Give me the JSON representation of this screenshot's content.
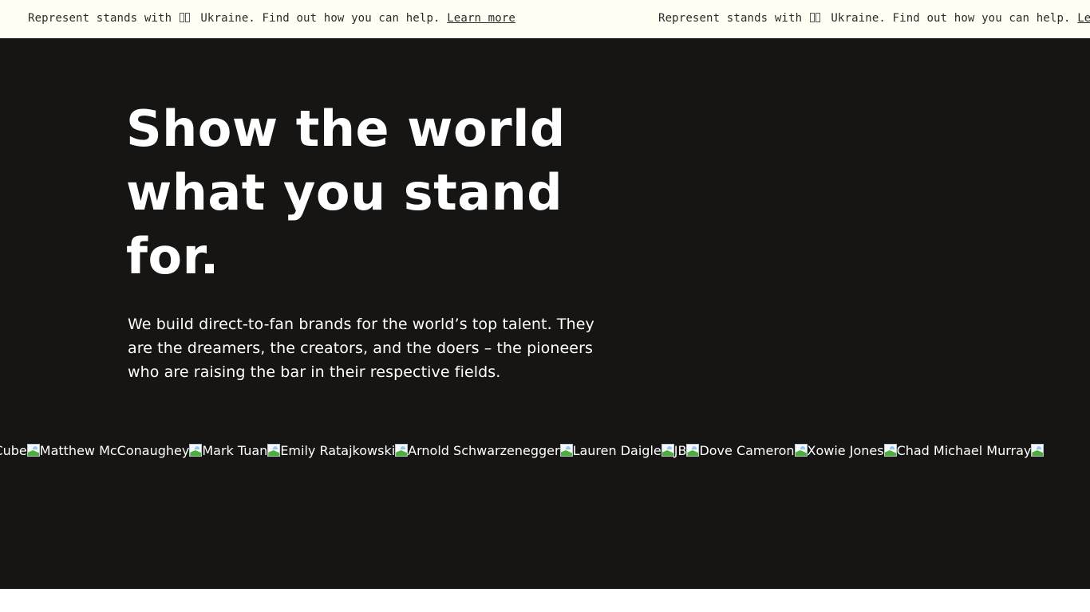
{
  "banner": {
    "message_prefix": "Represent stands with",
    "flag_icon": "ukraine-flag-icon",
    "message_suffix": "Ukraine. Find out how you can help.",
    "link_label": "Learn more",
    "link_label_truncated": "Lea",
    "background_color": "#fefef2"
  },
  "hero": {
    "headline": "Show the world what you stand for.",
    "lede": "We build direct-to-fan brands for the world’s top talent. They are the dreamers, the creators, and the doers – the pioneers who are raising the bar in their respective fields.",
    "background_color": "#161513"
  },
  "talent": [
    {
      "name": "Ice Cube",
      "icon": "broken-image-icon"
    },
    {
      "name": "Matthew McConaughey",
      "icon": "broken-image-icon"
    },
    {
      "name": "Mark Tuan",
      "icon": "broken-image-icon"
    },
    {
      "name": "Emily Ratajkowski",
      "icon": "broken-image-icon"
    },
    {
      "name": "Arnold Schwarzenegger",
      "icon": "broken-image-icon"
    },
    {
      "name": "Lauren Daigle",
      "icon": "broken-image-icon"
    },
    {
      "name": "JB",
      "icon": "broken-image-icon"
    },
    {
      "name": "Dove Cameron",
      "icon": "broken-image-icon"
    },
    {
      "name": "Xowie Jones",
      "icon": "broken-image-icon"
    },
    {
      "name": "Chad Michael Murray",
      "icon": "broken-image-icon"
    }
  ]
}
